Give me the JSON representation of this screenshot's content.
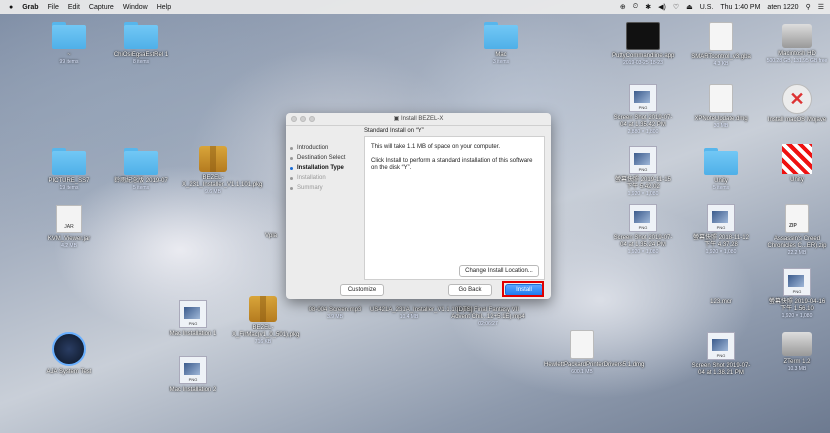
{
  "menubar": {
    "apple": "",
    "app": "Grab",
    "items": [
      "File",
      "Edit",
      "Capture",
      "Window",
      "Help"
    ],
    "status": [
      "⊕",
      "⏲",
      "✱",
      "◀)",
      "♡",
      "⏏",
      "U.S."
    ],
    "clock": "Thu 1:40 PM",
    "user": "aten 1220"
  },
  "desktop": {
    "folder_1": {
      "label": "~",
      "sub": "99 items"
    },
    "folder_2": {
      "label": "ChiOsiEgsaEstRel 1",
      "sub": "8 items"
    },
    "folder_3": {
      "label": "Mac",
      "sub": "3 items"
    },
    "folder_4": {
      "label": "Unity",
      "sub": "5 items"
    },
    "folder_5": {
      "label": "PICTURE_SS7",
      "sub": "19 items"
    },
    "folder_6": {
      "label": "鈴雨紀念版 2019-07",
      "sub": "5 items"
    },
    "jar": {
      "label": "KVM_Viewer.jar",
      "sub": "4.2 MB",
      "tag": "JAR"
    },
    "pkg_1": {
      "label": "BEZEL-X_231_Installer_V1.1.101.pkg",
      "sub": "9.6 MB"
    },
    "pkg_2": {
      "label": "BEZEL-X_FirMac(v1_0_501).pkg",
      "sub": "716 KB"
    },
    "vpla": {
      "label": "Vpla"
    },
    "asus": {
      "label": "AJA System Test"
    },
    "png_1": {
      "label": "Mac Installation 1",
      "tag": "PNG"
    },
    "png_2": {
      "label": "Mac Installation 2",
      "tag": "PNG"
    },
    "files_mid": {
      "label": "08-004 Screen.mp3",
      "sub": "3.9 MB"
    },
    "files_mid2": {
      "label": "US421A_231A_Installer_V1.1.101.pkg",
      "sub": "10.4 MB"
    },
    "files_mid3": {
      "label": "[DTS] Final Fantasy VII Advent Chil...12+5.1E).mp4",
      "sub": "02:06:27"
    },
    "dmg": {
      "label": "HewlettPackardPrinterDrivers5.1.dmg",
      "sub": "600.1 MB"
    },
    "term": {
      "label": "PuttyCommandline.app",
      "sub": "2019-03-25 18-23"
    },
    "doc_1": {
      "label": "SMARTcontrol_v3.gba",
      "sub": "4.3 KB",
      "tag": ""
    },
    "disk_1": {
      "label": "Macintosh HD",
      "sub": "500.28 GB, 131.95 GB free"
    },
    "ss_1": {
      "label": "Screen Shot 2019-07-04 at 1.35.42 PM",
      "sub": "2,880 × 1,800",
      "tag": "PNG"
    },
    "doc_2": {
      "label": "XPNoteUpdate.dmg",
      "sub": "30 MB",
      "tag": ""
    },
    "xapp": {
      "label": "Install macOS Mojave"
    },
    "ss_2": {
      "label": "螢幕快照 2019-11-15 下午 5.42.02",
      "sub": "1,920 × 1,080",
      "tag": "PNG"
    },
    "zz": {
      "label": "Unity"
    },
    "ss_3": {
      "label": "Screen Shot 2019-07-04 at 1.35.24 PM",
      "sub": "1,920 × 1,080",
      "tag": "PNG"
    },
    "ss_4": {
      "label": "螢幕快照 2018-11-12 下午 4.37.28",
      "sub": "1,920 × 1,080",
      "tag": "PNG"
    },
    "zip": {
      "label": "Assassin's Creed Chronicles C...ER).zip",
      "sub": "22.2 MB",
      "tag": "ZIP"
    },
    "ss_5": {
      "label": "螢幕快照 2019-04-16 下午 1.56.10",
      "sub": "1,920 × 1,080",
      "tag": "PNG"
    },
    "mcr": {
      "label": "123.mcr"
    },
    "ss_6": {
      "label": "Screen Shot 2019-07-04 at 1.38.21 PM",
      "tag": "PNG"
    },
    "zterm": {
      "label": "ZTerm 1.2",
      "sub": "10.3 MB"
    }
  },
  "installer": {
    "title": "Install BEZEL-X",
    "heading": "Standard Install on “Y”",
    "steps": [
      "Introduction",
      "Destination Select",
      "Installation Type",
      "Installation",
      "Summary"
    ],
    "body_1": "This will take 1.1 MB of space on your computer.",
    "body_2": "Click Install to perform a standard installation of this software on the disk “Y”.",
    "change_location": "Change Install Location...",
    "customize": "Customize",
    "go_back": "Go Back",
    "install": "Install",
    "accent": "#1e7bf0",
    "highlight": "#e00000"
  }
}
